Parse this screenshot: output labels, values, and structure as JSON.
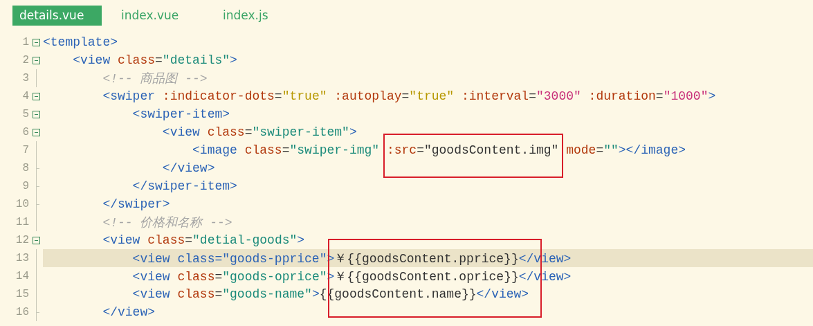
{
  "tabs": [
    {
      "label": "details.vue",
      "selected": true
    },
    {
      "label": "index.vue",
      "selected": false
    },
    {
      "label": "index.js",
      "selected": false
    }
  ],
  "editor": {
    "lines": [
      {
        "number": "1",
        "foldable": true,
        "current": false,
        "tokens": [
          {
            "kind": "tag",
            "text": "<template>"
          }
        ]
      },
      {
        "number": "2",
        "foldable": true,
        "current": false,
        "tokens": [
          {
            "kind": "tag",
            "text": "    <view"
          },
          {
            "kind": "attr",
            "text": " class"
          },
          {
            "kind": "plain",
            "text": "="
          },
          {
            "kind": "string",
            "text": "\"details\""
          },
          {
            "kind": "tag",
            "text": ">"
          }
        ]
      },
      {
        "number": "3",
        "foldable": false,
        "block_end": false,
        "current": false,
        "tokens": [
          {
            "kind": "comment",
            "text": "        <!-- 商品图 -->"
          }
        ]
      },
      {
        "number": "4",
        "foldable": true,
        "current": false,
        "tokens": [
          {
            "kind": "tag",
            "text": "        <swiper"
          },
          {
            "kind": "attr",
            "text": " :indicator-dots"
          },
          {
            "kind": "plain",
            "text": "="
          },
          {
            "kind": "bool",
            "text": "\"true\""
          },
          {
            "kind": "attr",
            "text": " :autoplay"
          },
          {
            "kind": "plain",
            "text": "="
          },
          {
            "kind": "bool",
            "text": "\"true\""
          },
          {
            "kind": "attr",
            "text": " :interval"
          },
          {
            "kind": "plain",
            "text": "="
          },
          {
            "kind": "number",
            "text": "\"3000\""
          },
          {
            "kind": "attr",
            "text": " :duration"
          },
          {
            "kind": "plain",
            "text": "="
          },
          {
            "kind": "number",
            "text": "\"1000\""
          },
          {
            "kind": "tag",
            "text": ">"
          }
        ]
      },
      {
        "number": "5",
        "foldable": true,
        "current": false,
        "tokens": [
          {
            "kind": "tag",
            "text": "            <swiper-item>"
          }
        ]
      },
      {
        "number": "6",
        "foldable": true,
        "current": false,
        "tokens": [
          {
            "kind": "tag",
            "text": "                <view"
          },
          {
            "kind": "attr",
            "text": " class"
          },
          {
            "kind": "plain",
            "text": "="
          },
          {
            "kind": "string",
            "text": "\"swiper-item\""
          },
          {
            "kind": "tag",
            "text": ">"
          }
        ]
      },
      {
        "number": "7",
        "foldable": false,
        "block_end": false,
        "current": false,
        "tokens": [
          {
            "kind": "tag",
            "text": "                    <image"
          },
          {
            "kind": "attr",
            "text": " class"
          },
          {
            "kind": "plain",
            "text": "="
          },
          {
            "kind": "string",
            "text": "\"swiper-img\""
          },
          {
            "kind": "attr",
            "text": " :src"
          },
          {
            "kind": "plain",
            "text": "=\"goodsContent.img\""
          },
          {
            "kind": "attr",
            "text": " mode"
          },
          {
            "kind": "plain",
            "text": "="
          },
          {
            "kind": "string",
            "text": "\"\""
          },
          {
            "kind": "tag",
            "text": "></image>"
          }
        ]
      },
      {
        "number": "8",
        "foldable": false,
        "block_end": true,
        "current": false,
        "tokens": [
          {
            "kind": "tag",
            "text": "                </view>"
          }
        ]
      },
      {
        "number": "9",
        "foldable": false,
        "block_end": true,
        "current": false,
        "tokens": [
          {
            "kind": "tag",
            "text": "            </swiper-item>"
          }
        ]
      },
      {
        "number": "10",
        "foldable": false,
        "block_end": true,
        "current": false,
        "tokens": [
          {
            "kind": "tag",
            "text": "        </swiper>"
          }
        ]
      },
      {
        "number": "11",
        "foldable": false,
        "block_end": false,
        "current": false,
        "tokens": [
          {
            "kind": "comment",
            "text": "        <!-- 价格和名称 -->"
          }
        ]
      },
      {
        "number": "12",
        "foldable": true,
        "current": false,
        "tokens": [
          {
            "kind": "tag",
            "text": "        <view"
          },
          {
            "kind": "attr",
            "text": " class"
          },
          {
            "kind": "plain",
            "text": "="
          },
          {
            "kind": "string",
            "text": "\"detial-goods\""
          },
          {
            "kind": "tag",
            "text": ">"
          }
        ]
      },
      {
        "number": "13",
        "foldable": false,
        "block_end": false,
        "current": true,
        "tokens": [
          {
            "kind": "tag",
            "text": "            <view class=\"goods-pprice\""
          },
          {
            "kind": "tag",
            "text": ">"
          },
          {
            "kind": "plain",
            "text": "￥{{goodsContent.pprice}}"
          },
          {
            "kind": "tag",
            "text": "</view>"
          }
        ]
      },
      {
        "number": "14",
        "foldable": false,
        "block_end": false,
        "current": false,
        "tokens": [
          {
            "kind": "tag",
            "text": "            <view"
          },
          {
            "kind": "attr",
            "text": " class"
          },
          {
            "kind": "plain",
            "text": "="
          },
          {
            "kind": "string",
            "text": "\"goods-oprice\""
          },
          {
            "kind": "tag",
            "text": ">"
          },
          {
            "kind": "plain",
            "text": "￥{{goodsContent.oprice}}"
          },
          {
            "kind": "tag",
            "text": "</view>"
          }
        ]
      },
      {
        "number": "15",
        "foldable": false,
        "block_end": false,
        "current": false,
        "tokens": [
          {
            "kind": "tag",
            "text": "            <view"
          },
          {
            "kind": "attr",
            "text": " class"
          },
          {
            "kind": "plain",
            "text": "="
          },
          {
            "kind": "string",
            "text": "\"goods-name\""
          },
          {
            "kind": "tag",
            "text": ">"
          },
          {
            "kind": "plain",
            "text": "{{goodsContent.name}}"
          },
          {
            "kind": "tag",
            "text": "</view>"
          }
        ]
      },
      {
        "number": "16",
        "foldable": false,
        "block_end": true,
        "current": false,
        "tokens": [
          {
            "kind": "tag",
            "text": "        </view>"
          }
        ]
      }
    ]
  }
}
